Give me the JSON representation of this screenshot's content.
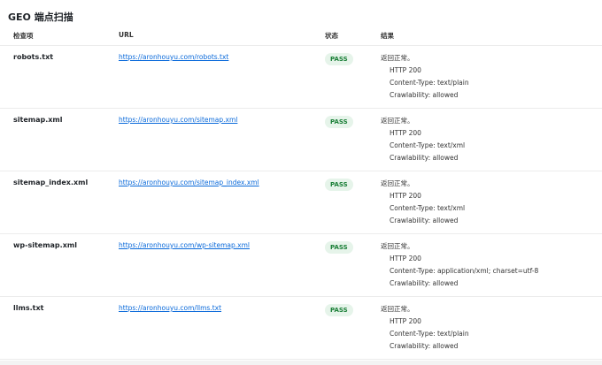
{
  "title": "GEO 端点扫描",
  "headers": {
    "name": "检查项",
    "url": "URL",
    "status": "状态",
    "result": "结果"
  },
  "rows": [
    {
      "name": "robots.txt",
      "url": "https://aronhouyu.com/robots.txt",
      "status": "PASS",
      "result_title": "返回正常。",
      "result_lines": [
        "HTTP 200",
        "Content-Type: text/plain",
        "Crawlability: allowed"
      ]
    },
    {
      "name": "sitemap.xml",
      "url": "https://aronhouyu.com/sitemap.xml",
      "status": "PASS",
      "result_title": "返回正常。",
      "result_lines": [
        "HTTP 200",
        "Content-Type: text/xml",
        "Crawlability: allowed"
      ]
    },
    {
      "name": "sitemap_index.xml",
      "url": "https://aronhouyu.com/sitemap_index.xml",
      "status": "PASS",
      "result_title": "返回正常。",
      "result_lines": [
        "HTTP 200",
        "Content-Type: text/xml",
        "Crawlability: allowed"
      ]
    },
    {
      "name": "wp-sitemap.xml",
      "url": "https://aronhouyu.com/wp-sitemap.xml",
      "status": "PASS",
      "result_title": "返回正常。",
      "result_lines": [
        "HTTP 200",
        "Content-Type: application/xml; charset=utf-8",
        "Crawlability: allowed"
      ]
    },
    {
      "name": "llms.txt",
      "url": "https://aronhouyu.com/llms.txt",
      "status": "PASS",
      "result_title": "返回正常。",
      "result_lines": [
        "HTTP 200",
        "Content-Type: text/plain",
        "Crawlability: allowed"
      ]
    }
  ],
  "colors": {
    "pass_bg": "#e6f4ea",
    "pass_text": "#1a7f37",
    "link": "#0969da"
  }
}
